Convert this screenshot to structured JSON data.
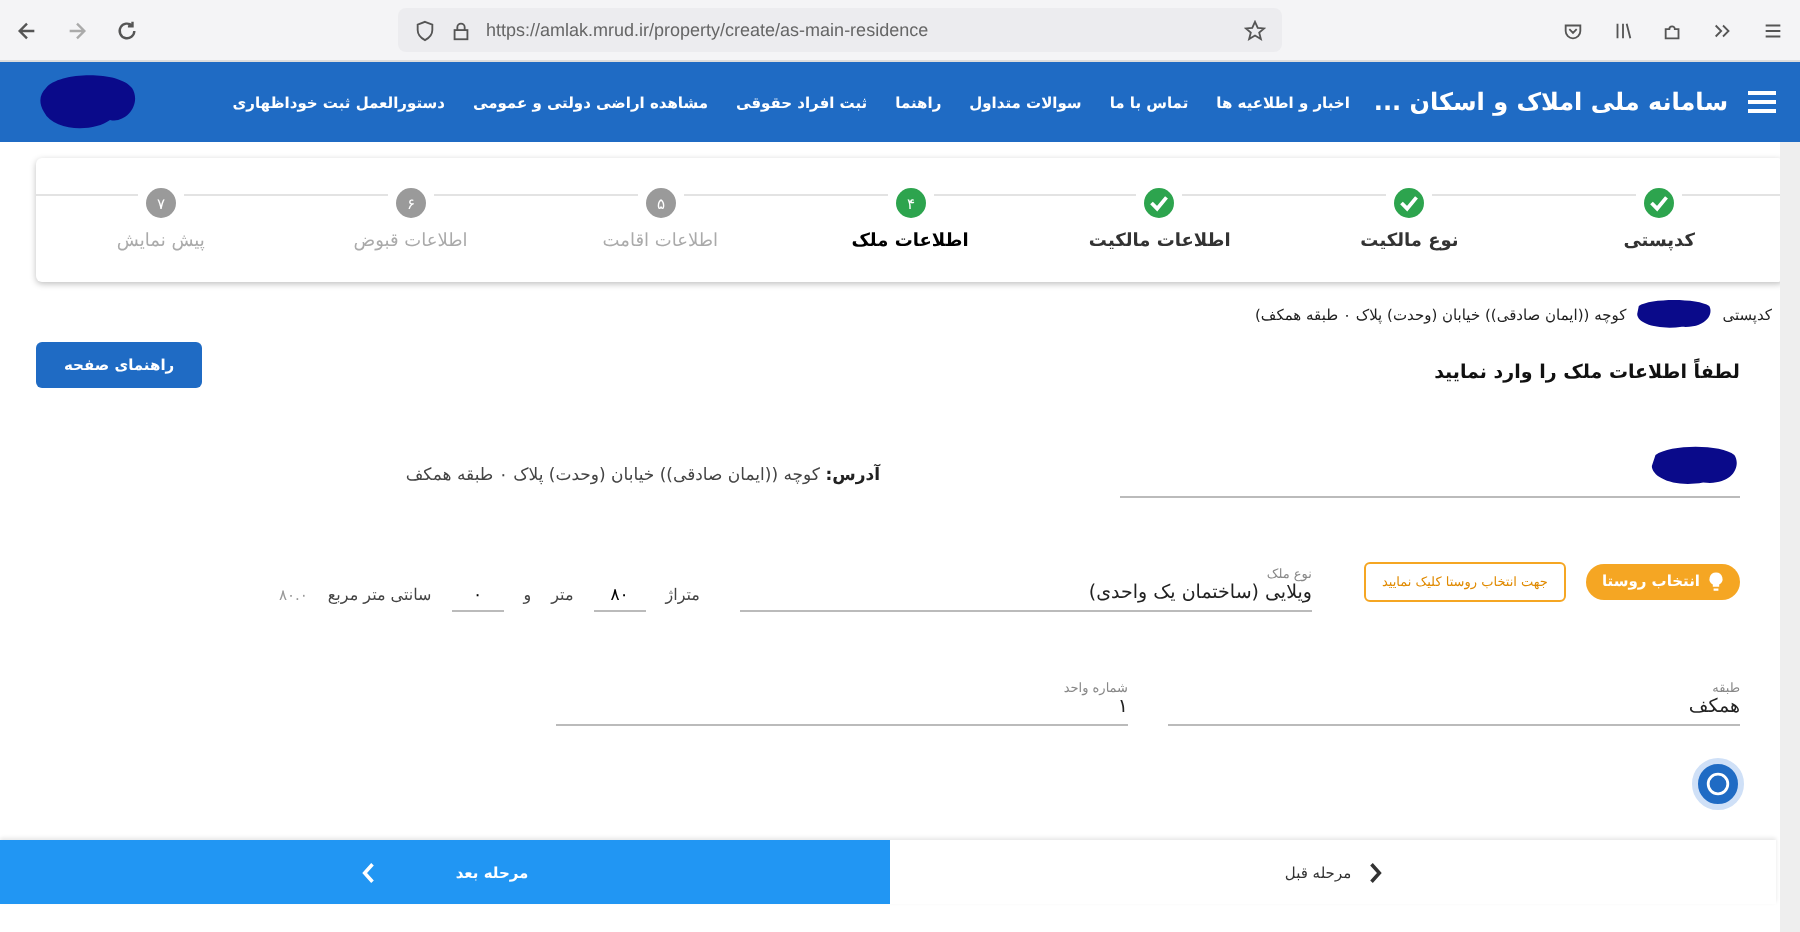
{
  "browser": {
    "url": "https://amlak.mrud.ir/property/create/as-main-residence"
  },
  "header": {
    "title": "سامانه ملی املاک و اسکان ...",
    "nav": [
      "اخبار و اطلاعیه ها",
      "تماس با ما",
      "سوالات متداول",
      "راهنما",
      "ثبت افراد حقوقی",
      "مشاهده اراضی دولتی و عمومی",
      "دستورالعمل ثبت خوداظهاری"
    ]
  },
  "steps": [
    {
      "label": "کدپستی",
      "done": true,
      "selected": false
    },
    {
      "label": "نوع مالکیت",
      "done": true,
      "selected": false
    },
    {
      "label": "اطلاعات مالکیت",
      "done": true,
      "selected": false
    },
    {
      "label": "اطلاعات ملک",
      "number": "۴",
      "done": false,
      "selected": true
    },
    {
      "label": "اطلاعات اقامت",
      "number": "۵",
      "done": false,
      "selected": false
    },
    {
      "label": "اطلاعات قبوض",
      "number": "۶",
      "done": false,
      "selected": false
    },
    {
      "label": "پیش نمایش",
      "number": "۷",
      "done": false,
      "selected": false
    }
  ],
  "breadcrumb": {
    "label": "کدپستی",
    "value": "کوچه ((ایمان صادقی)) خیابان (وحدت) پلاک ۰ طبقه همکف)"
  },
  "form": {
    "heading": "لطفاً اطلاعات ملک را وارد نمایید",
    "help_button": "راهنمای صفحه",
    "address_line": [
      {
        "kind": "redacted_field"
      },
      {
        "kind": "text",
        "label": "آدرس:",
        "value": "کوچه ((ایمان صادقی)) خیابان (وحدت) پلاک ۰ طبقه همکف"
      }
    ],
    "property_line": [
      {
        "kind": "pill",
        "label": "انتخاب روستا"
      },
      {
        "kind": "outline",
        "label": "جهت انتخاب روستا کلیک نمایید"
      },
      {
        "kind": "field",
        "label": "نوع ملک",
        "value": "ویلایی (ساختمان یک واحدی)"
      },
      {
        "kind": "caption",
        "label": "متراژ"
      },
      {
        "kind": "small_field",
        "value": "۸۰"
      },
      {
        "kind": "caption",
        "label": "متر"
      },
      {
        "kind": "caption",
        "label": "و"
      },
      {
        "kind": "small_field",
        "value": "۰"
      },
      {
        "kind": "caption",
        "label": "سانتی متر مربع"
      },
      {
        "kind": "hint",
        "label": "۸۰.۰"
      }
    ],
    "unit_line": [
      {
        "kind": "field",
        "label": "طبقه",
        "value": "همکف"
      },
      {
        "kind": "field",
        "label": "شماره واحد",
        "value": "۱"
      }
    ]
  },
  "footer": {
    "next": "مرحله بعد",
    "prev": "مرحله قبل"
  }
}
